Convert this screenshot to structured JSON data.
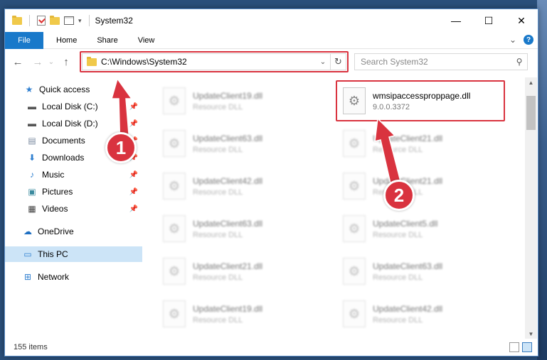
{
  "window": {
    "title": "System32",
    "minimize": "—",
    "maximize": "☐",
    "close": "✕"
  },
  "ribbon": {
    "tabs": [
      "File",
      "Home",
      "Share",
      "View"
    ],
    "expand": "⌄",
    "help": "?"
  },
  "nav": {
    "back": "←",
    "forward": "→",
    "recent": "⌄",
    "up": "↑",
    "address": "C:\\Windows\\System32",
    "address_dropdown": "⌄",
    "refresh": "↻",
    "search_placeholder": "Search System32",
    "search_icon": "⚲"
  },
  "sidebar": {
    "items": [
      {
        "label": "Quick access",
        "icon": "star-icon"
      },
      {
        "label": "Local Disk (C:)",
        "icon": "drive-icon",
        "pinned": true
      },
      {
        "label": "Local Disk (D:)",
        "icon": "drive-icon",
        "pinned": true
      },
      {
        "label": "Documents",
        "icon": "documents-icon",
        "pinned": true
      },
      {
        "label": "Downloads",
        "icon": "downloads-icon",
        "pinned": true
      },
      {
        "label": "Music",
        "icon": "music-icon",
        "pinned": true
      },
      {
        "label": "Pictures",
        "icon": "pictures-icon",
        "pinned": true
      },
      {
        "label": "Videos",
        "icon": "videos-icon",
        "pinned": true
      },
      {
        "label": "OneDrive",
        "icon": "cloud-icon"
      },
      {
        "label": "This PC",
        "icon": "computer-icon",
        "selected": true
      },
      {
        "label": "Network",
        "icon": "network-icon"
      }
    ],
    "pin_glyph": "📌"
  },
  "files": {
    "left_column": [
      {
        "name": "UpdateClient19.dll",
        "type": "Resource DLL"
      },
      {
        "name": "UpdateClient63.dll",
        "type": "Resource DLL"
      },
      {
        "name": "UpdateClient42.dll",
        "type": "Resource DLL"
      },
      {
        "name": "UpdateClient63.dll",
        "type": "Resource DLL"
      },
      {
        "name": "UpdateClient21.dll",
        "type": "Resource DLL"
      },
      {
        "name": "UpdateClient19.dll",
        "type": "Resource DLL"
      }
    ],
    "right_column": [
      {
        "name": "wmsipaccessproppage.dll",
        "type": "9.0.0.3372",
        "highlighted": true
      },
      {
        "name": "UpdateClient21.dll",
        "type": "Resource DLL"
      },
      {
        "name": "UpdateClient21.dll",
        "type": "Resource DLL"
      },
      {
        "name": "UpdateClient5.dll",
        "type": "Resource DLL"
      },
      {
        "name": "UpdateClient63.dll",
        "type": "Resource DLL"
      },
      {
        "name": "UpdateClient42.dll",
        "type": "Resource DLL"
      }
    ]
  },
  "status": {
    "item_count": "155 items"
  },
  "annotations": {
    "step1": "1",
    "step2": "2",
    "color": "#d9333f"
  }
}
